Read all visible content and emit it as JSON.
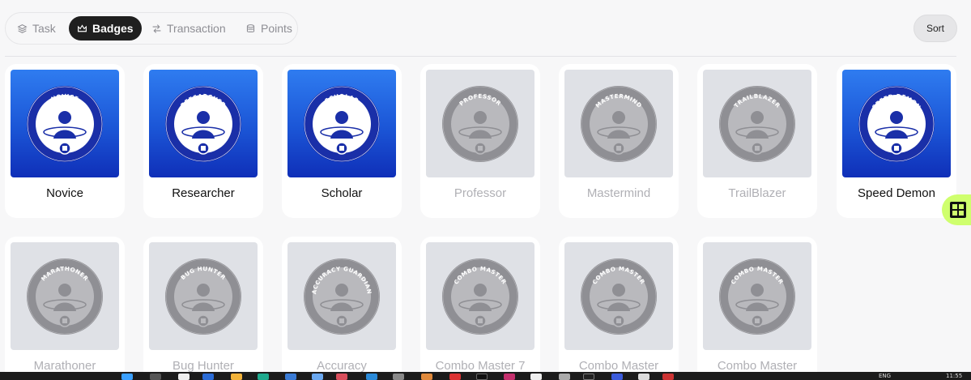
{
  "tabs": [
    {
      "label": "Task",
      "icon": "layers-icon",
      "active": false
    },
    {
      "label": "Badges",
      "icon": "crown-icon",
      "active": true
    },
    {
      "label": "Transaction",
      "icon": "transaction-icon",
      "active": false
    },
    {
      "label": "Points",
      "icon": "coins-icon",
      "active": false
    }
  ],
  "sort_label": "Sort",
  "badges": [
    {
      "name": "Novice",
      "ring_text": "NOVICE",
      "earned": true
    },
    {
      "name": "Researcher",
      "ring_text": "REESARCHER",
      "earned": true
    },
    {
      "name": "Scholar",
      "ring_text": "SCHOLAR",
      "earned": true
    },
    {
      "name": "Professor",
      "ring_text": "PROFESSOR",
      "earned": false
    },
    {
      "name": "Mastermind",
      "ring_text": "MASTERMIND",
      "earned": false
    },
    {
      "name": "TrailBlazer",
      "ring_text": "TRAILBLAZER",
      "earned": false
    },
    {
      "name": "Speed Demon",
      "ring_text": "SPEED DEMON",
      "earned": true
    },
    {
      "name": "Marathoner",
      "ring_text": "MARATHONER",
      "earned": false
    },
    {
      "name": "Bug Hunter",
      "ring_text": "BUG HUNTER",
      "earned": false
    },
    {
      "name": "Accuracy",
      "ring_text": "ACCURACY GUARDIAN",
      "earned": false
    },
    {
      "name": "Combo Master 7",
      "ring_text": "COMBO MASTER",
      "earned": false
    },
    {
      "name": "Combo Master",
      "ring_text": "COMBO MASTER",
      "earned": false
    },
    {
      "name": "Combo Master",
      "ring_text": "COMBO MASTER",
      "earned": false
    }
  ],
  "colors": {
    "earned_top": "#2f7cf0",
    "earned_bottom": "#0f2fb8",
    "locked_bg": "#dfe1e6",
    "active_tab": "#1f1f1f",
    "fab": "#cfff6e"
  },
  "taskbar": {
    "language": "ENG",
    "time": "11:55"
  }
}
